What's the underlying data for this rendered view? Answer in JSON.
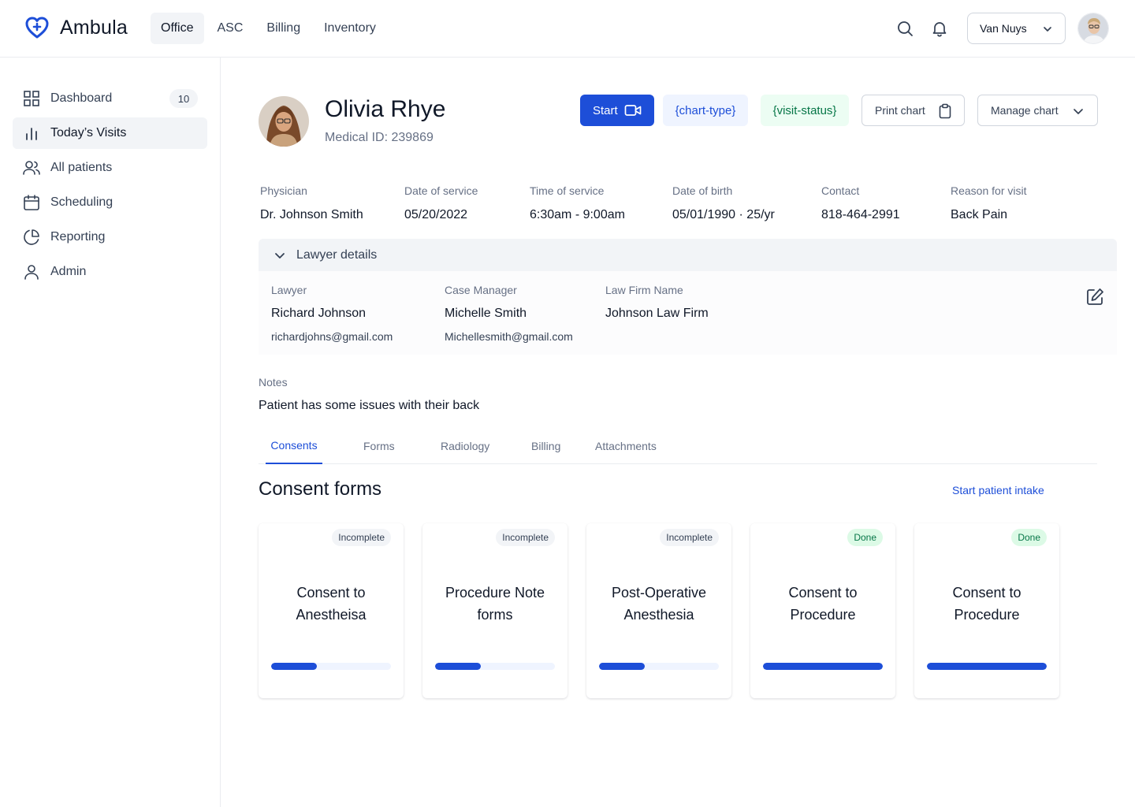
{
  "brand": {
    "name": "Ambula",
    "accent": "#1d4ed8"
  },
  "nav": [
    {
      "label": "Office",
      "active": true
    },
    {
      "label": "ASC",
      "active": false
    },
    {
      "label": "Billing",
      "active": false
    },
    {
      "label": "Inventory",
      "active": false
    }
  ],
  "header": {
    "location": "Van Nuys"
  },
  "sidebar": {
    "items": [
      {
        "label": "Dashboard",
        "icon": "grid-icon",
        "badge": "10"
      },
      {
        "label": "Today’s Visits",
        "icon": "bar-chart-icon",
        "active": true
      },
      {
        "label": "All patients",
        "icon": "users-icon"
      },
      {
        "label": "Scheduling",
        "icon": "calendar-icon"
      },
      {
        "label": "Reporting",
        "icon": "pie-chart-icon"
      },
      {
        "label": "Admin",
        "icon": "user-icon"
      }
    ]
  },
  "patient": {
    "name": "Olivia Rhye",
    "medical_id": "Medical ID: 239869"
  },
  "actions": {
    "start": "Start",
    "chart_type": "{chart-type}",
    "visit_status": "{visit-status}",
    "print_chart": "Print chart",
    "manage_chart": "Manage chart"
  },
  "info": [
    {
      "label": "Physician",
      "value": "Dr. Johnson Smith"
    },
    {
      "label": "Date of service",
      "value": "05/20/2022"
    },
    {
      "label": "Time of service",
      "value": "6:30am - 9:00am"
    },
    {
      "label": "Date of birth",
      "value": "05/01/1990 · 25/yr"
    },
    {
      "label": "Contact",
      "value": "818-464-2991"
    },
    {
      "label": "Reason for visit",
      "value": "Back Pain"
    }
  ],
  "lawyer": {
    "header": "Lawyer details",
    "lawyer_label": "Lawyer",
    "lawyer_name": "Richard Johnson",
    "lawyer_email": "richardjohns@gmail.com",
    "manager_label": "Case Manager",
    "manager_name": "Michelle Smith",
    "manager_email": "Michellesmith@gmail.com",
    "firm_label": "Law Firm Name",
    "firm_name": "Johnson Law Firm"
  },
  "notes": {
    "label": "Notes",
    "value": "Patient has some issues with their back"
  },
  "tabs": [
    {
      "label": "Consents",
      "active": true
    },
    {
      "label": "Forms"
    },
    {
      "label": "Radiology"
    },
    {
      "label": "Billing"
    },
    {
      "label": "Attachments"
    }
  ],
  "consents": {
    "title": "Consent forms",
    "intake_link": "Start patient intake",
    "cards": [
      {
        "status": "Incomplete",
        "title": "Consent to Anestheisa",
        "progress": 0.38
      },
      {
        "status": "Incomplete",
        "title": "Procedure Note forms",
        "progress": 0.38
      },
      {
        "status": "Incomplete",
        "title": "Post-Operative Anesthesia",
        "progress": 0.38
      },
      {
        "status": "Done",
        "title": "Consent to Procedure",
        "progress": 1.0
      },
      {
        "status": "Done",
        "title": "Consent to Procedure",
        "progress": 1.0
      }
    ]
  }
}
